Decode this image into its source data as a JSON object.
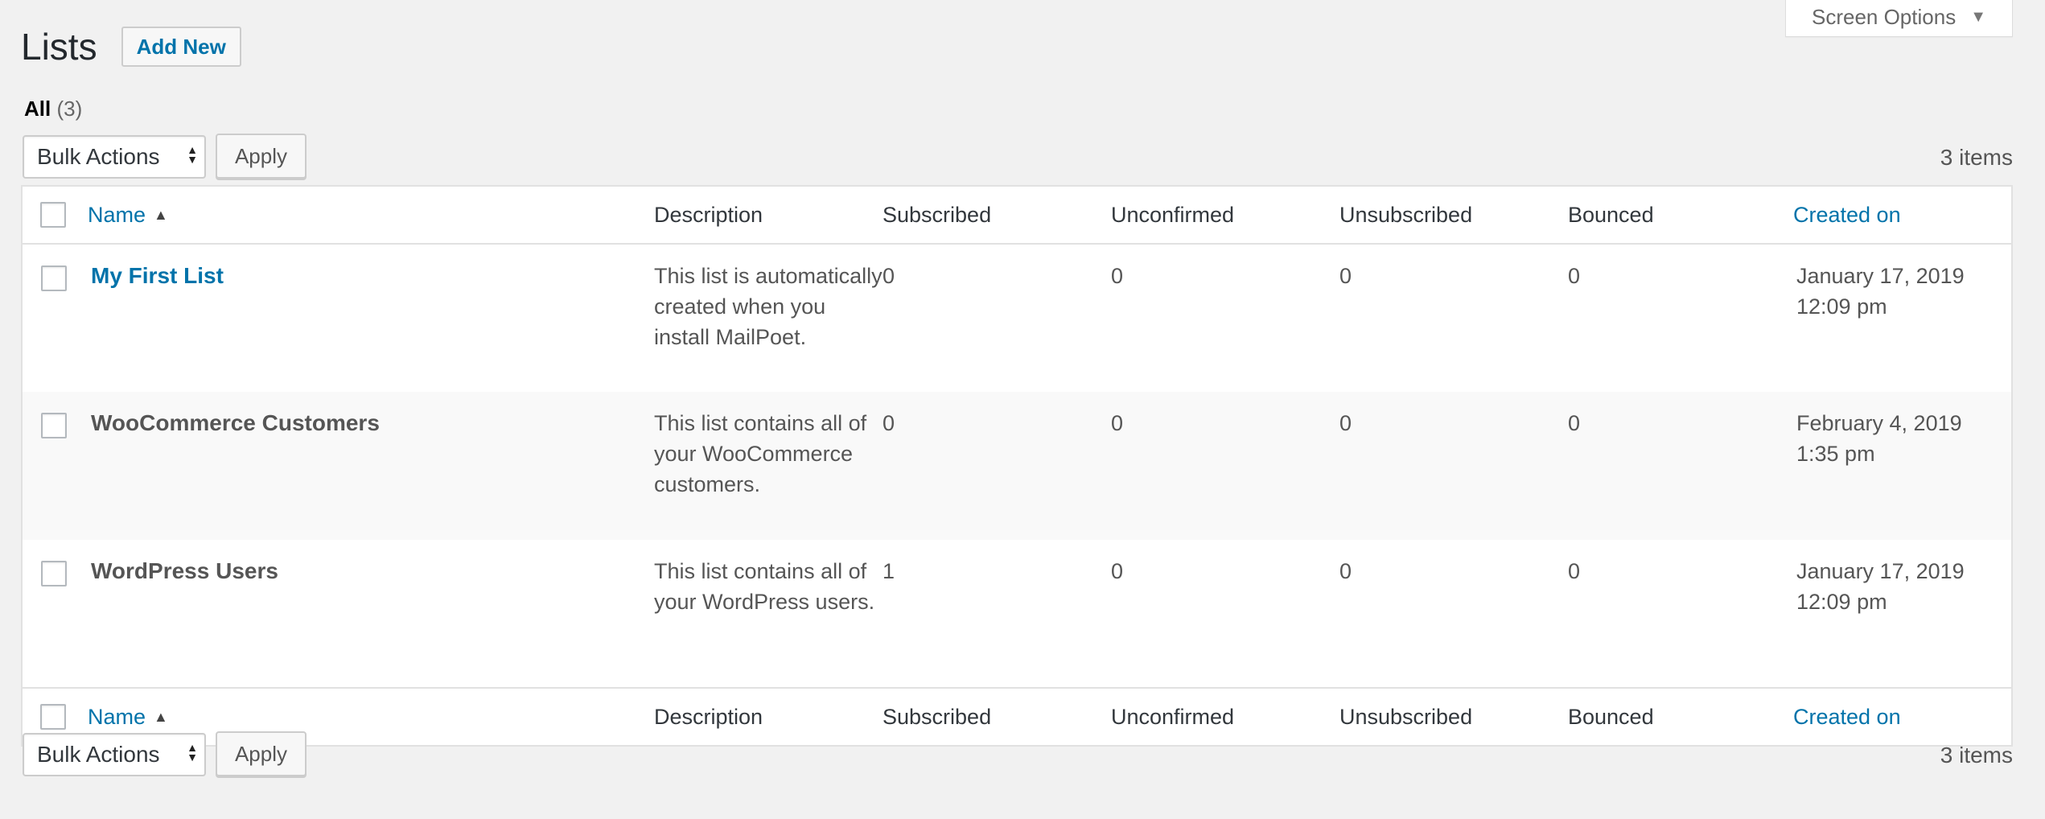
{
  "screen_options": {
    "label": "Screen Options",
    "icon": "triangle-down-icon"
  },
  "page": {
    "title": "Lists",
    "add_new": "Add New"
  },
  "filter": {
    "all_label": "All",
    "all_count": "(3)"
  },
  "tablenav": {
    "bulk_actions": "Bulk Actions",
    "apply": "Apply",
    "item_count": "3 items"
  },
  "columns": {
    "name": "Name",
    "description": "Description",
    "subscribed": "Subscribed",
    "unconfirmed": "Unconfirmed",
    "unsubscribed": "Unsubscribed",
    "bounced": "Bounced",
    "created_on": "Created on"
  },
  "rows": [
    {
      "name": "My First List",
      "description": "This list is automatically created when you install MailPoet.",
      "subscribed": "0",
      "unconfirmed": "0",
      "unsubscribed": "0",
      "bounced": "0",
      "created_date": "January 17, 2019",
      "created_time": "12:09 pm"
    },
    {
      "name": "WooCommerce Customers",
      "description": "This list contains all of your WooCommerce customers.",
      "subscribed": "0",
      "unconfirmed": "0",
      "unsubscribed": "0",
      "bounced": "0",
      "created_date": "February 4, 2019",
      "created_time": "1:35 pm"
    },
    {
      "name": "WordPress Users",
      "description": "This list contains all of your WordPress users.",
      "subscribed": "1",
      "unconfirmed": "0",
      "unsubscribed": "0",
      "bounced": "0",
      "created_date": "January 17, 2019",
      "created_time": "12:09 pm"
    }
  ],
  "colors": {
    "link": "#0073aa",
    "background": "#f1f1f1",
    "text": "#444444"
  }
}
